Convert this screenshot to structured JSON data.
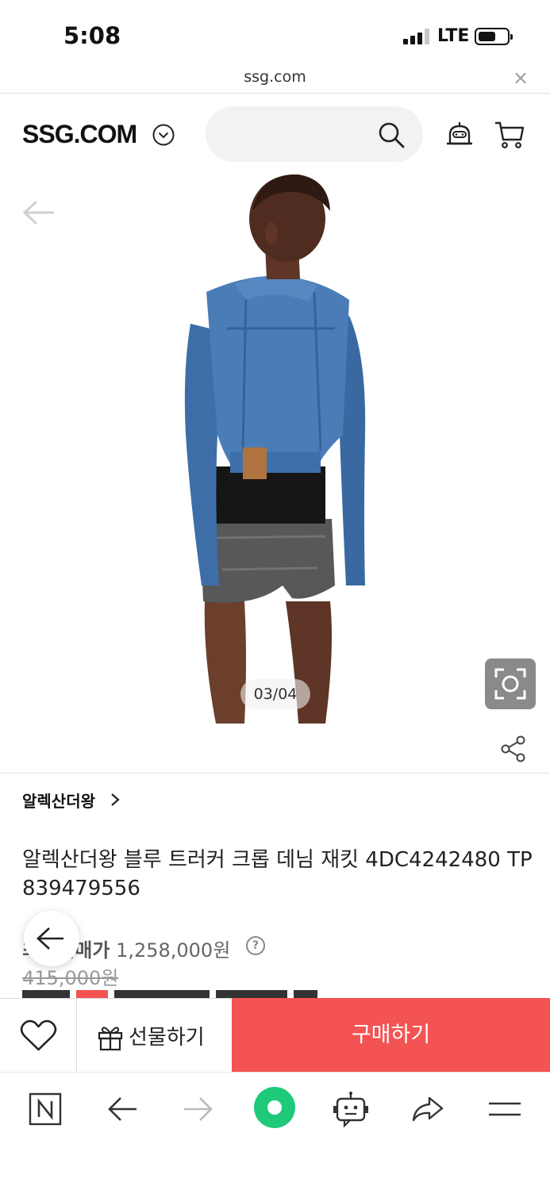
{
  "status_bar": {
    "time": "5:08",
    "network": "LTE"
  },
  "browser": {
    "url": "ssg.com",
    "close_glyph": "×"
  },
  "header": {
    "logo": "SSG.COM",
    "search_placeholder": ""
  },
  "gallery": {
    "pager": "03/04"
  },
  "product": {
    "brand": "알렉산더왕",
    "title": "알렉산더왕 블루 트러커 크롭 데님 재킷 4DC4242480 TP 839479556",
    "max_price_label": "최고판매가",
    "max_price_value": "1,258,000원",
    "original_price": "415,000원"
  },
  "actions": {
    "gift_label": "선물하기",
    "buy_label": "구매하기"
  },
  "colors": {
    "buy": "#f35352",
    "brand_green": "#1ec97a"
  },
  "icons": [
    "search-icon",
    "bell-icon",
    "cart-icon",
    "heart-icon",
    "gift-icon",
    "share-icon",
    "lens-icon",
    "back-arrow-icon",
    "naver-icon",
    "forward-arrow-icon",
    "home-dot-icon",
    "bot-icon",
    "menu-icon"
  ]
}
